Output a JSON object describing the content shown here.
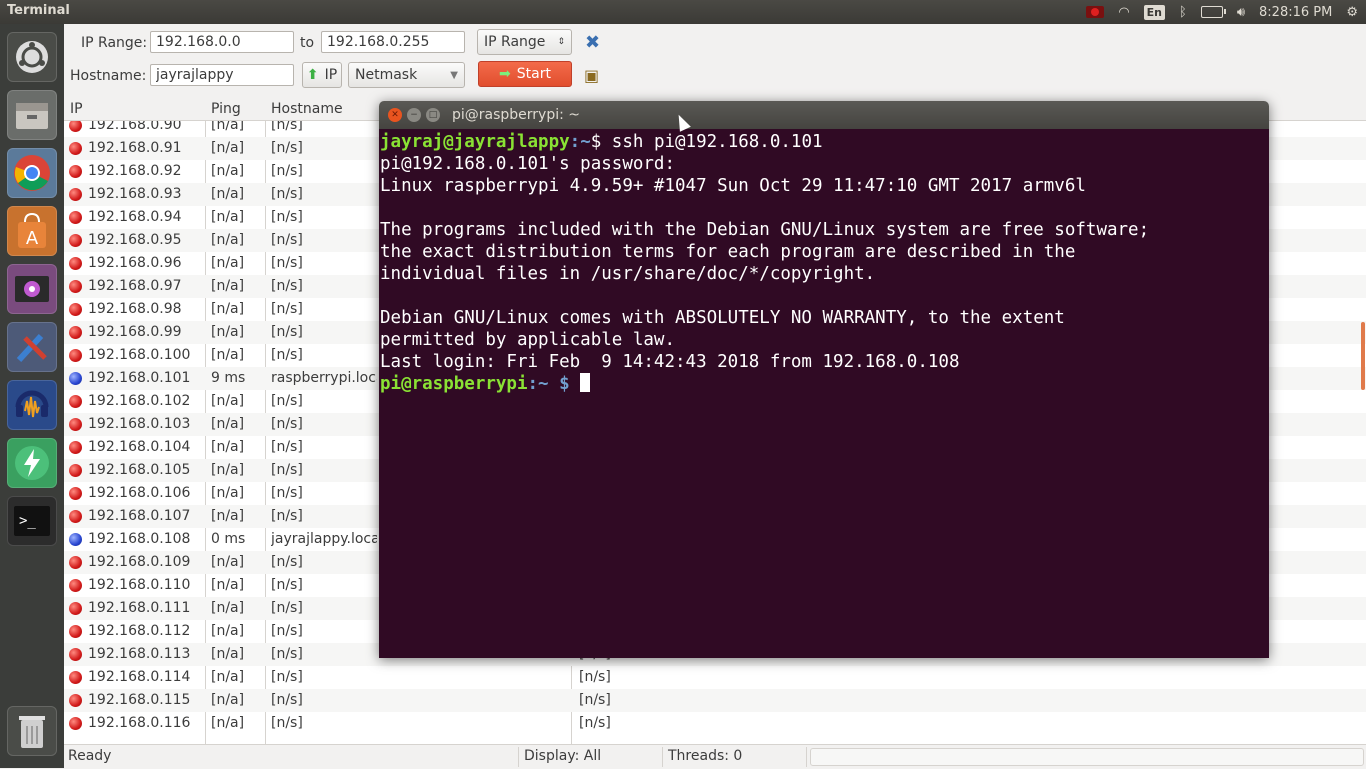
{
  "top_panel": {
    "title": "Terminal",
    "keyboard": "En",
    "clock": "8:28:16 PM"
  },
  "launcher": {
    "items": [
      "ubuntu-dash",
      "files",
      "chrome",
      "software-center",
      "video",
      "tools",
      "audacity",
      "power",
      "terminal",
      "trash"
    ]
  },
  "toolbar": {
    "ip_range_label": "IP Range:",
    "ip_from": "192.168.0.0",
    "to_label": "to",
    "ip_to": "192.168.0.255",
    "range_type": "IP Range",
    "hostname_label": "Hostname:",
    "hostname": "jayrajlappy",
    "ip_button": "IP",
    "netmask": "Netmask",
    "start_button": "Start"
  },
  "table": {
    "headers": {
      "ip": "IP",
      "ping": "Ping",
      "hostname": "Hostname"
    },
    "rows": [
      {
        "ip": "192.168.0.90",
        "ping": "[n/a]",
        "host": "[n/s]",
        "ports": "",
        "alive": false
      },
      {
        "ip": "192.168.0.91",
        "ping": "[n/a]",
        "host": "[n/s]",
        "ports": "",
        "alive": false
      },
      {
        "ip": "192.168.0.92",
        "ping": "[n/a]",
        "host": "[n/s]",
        "ports": "",
        "alive": false
      },
      {
        "ip": "192.168.0.93",
        "ping": "[n/a]",
        "host": "[n/s]",
        "ports": "",
        "alive": false
      },
      {
        "ip": "192.168.0.94",
        "ping": "[n/a]",
        "host": "[n/s]",
        "ports": "",
        "alive": false
      },
      {
        "ip": "192.168.0.95",
        "ping": "[n/a]",
        "host": "[n/s]",
        "ports": "",
        "alive": false
      },
      {
        "ip": "192.168.0.96",
        "ping": "[n/a]",
        "host": "[n/s]",
        "ports": "",
        "alive": false
      },
      {
        "ip": "192.168.0.97",
        "ping": "[n/a]",
        "host": "[n/s]",
        "ports": "",
        "alive": false
      },
      {
        "ip": "192.168.0.98",
        "ping": "[n/a]",
        "host": "[n/s]",
        "ports": "",
        "alive": false
      },
      {
        "ip": "192.168.0.99",
        "ping": "[n/a]",
        "host": "[n/s]",
        "ports": "",
        "alive": false
      },
      {
        "ip": "192.168.0.100",
        "ping": "[n/a]",
        "host": "[n/s]",
        "ports": "",
        "alive": false
      },
      {
        "ip": "192.168.0.101",
        "ping": "9 ms",
        "host": "raspberrypi.local",
        "ports": "",
        "alive": true
      },
      {
        "ip": "192.168.0.102",
        "ping": "[n/a]",
        "host": "[n/s]",
        "ports": "",
        "alive": false
      },
      {
        "ip": "192.168.0.103",
        "ping": "[n/a]",
        "host": "[n/s]",
        "ports": "",
        "alive": false
      },
      {
        "ip": "192.168.0.104",
        "ping": "[n/a]",
        "host": "[n/s]",
        "ports": "",
        "alive": false
      },
      {
        "ip": "192.168.0.105",
        "ping": "[n/a]",
        "host": "[n/s]",
        "ports": "",
        "alive": false
      },
      {
        "ip": "192.168.0.106",
        "ping": "[n/a]",
        "host": "[n/s]",
        "ports": "",
        "alive": false
      },
      {
        "ip": "192.168.0.107",
        "ping": "[n/a]",
        "host": "[n/s]",
        "ports": "",
        "alive": false
      },
      {
        "ip": "192.168.0.108",
        "ping": "0 ms",
        "host": "jayrajlappy.local",
        "ports": "",
        "alive": true
      },
      {
        "ip": "192.168.0.109",
        "ping": "[n/a]",
        "host": "[n/s]",
        "ports": "",
        "alive": false
      },
      {
        "ip": "192.168.0.110",
        "ping": "[n/a]",
        "host": "[n/s]",
        "ports": "",
        "alive": false
      },
      {
        "ip": "192.168.0.111",
        "ping": "[n/a]",
        "host": "[n/s]",
        "ports": "",
        "alive": false
      },
      {
        "ip": "192.168.0.112",
        "ping": "[n/a]",
        "host": "[n/s]",
        "ports": "",
        "alive": false
      },
      {
        "ip": "192.168.0.113",
        "ping": "[n/a]",
        "host": "[n/s]",
        "ports": "[n/s]",
        "alive": false
      },
      {
        "ip": "192.168.0.114",
        "ping": "[n/a]",
        "host": "[n/s]",
        "ports": "[n/s]",
        "alive": false
      },
      {
        "ip": "192.168.0.115",
        "ping": "[n/a]",
        "host": "[n/s]",
        "ports": "[n/s]",
        "alive": false
      },
      {
        "ip": "192.168.0.116",
        "ping": "[n/a]",
        "host": "[n/s]",
        "ports": "[n/s]",
        "alive": false
      }
    ]
  },
  "status": {
    "state": "Ready",
    "display": "Display: All",
    "threads": "Threads: 0"
  },
  "terminal": {
    "title": "pi@raspberrypi: ~",
    "line1_user": "jayraj@jayrajlappy",
    "line1_path": ":~",
    "line1_cmd": "$ ssh pi@192.168.0.101",
    "line2": "pi@192.168.0.101's password:",
    "line3": "Linux raspberrypi 4.9.59+ #1047 Sun Oct 29 11:47:10 GMT 2017 armv6l",
    "line4": "The programs included with the Debian GNU/Linux system are free software;",
    "line5": "the exact distribution terms for each program are described in the",
    "line6": "individual files in /usr/share/doc/*/copyright.",
    "line7": "Debian GNU/Linux comes with ABSOLUTELY NO WARRANTY, to the extent",
    "line8": "permitted by applicable law.",
    "line9": "Last login: Fri Feb  9 14:42:43 2018 from 192.168.0.108",
    "prompt_user": "pi@raspberrypi",
    "prompt_path": ":~ $"
  }
}
